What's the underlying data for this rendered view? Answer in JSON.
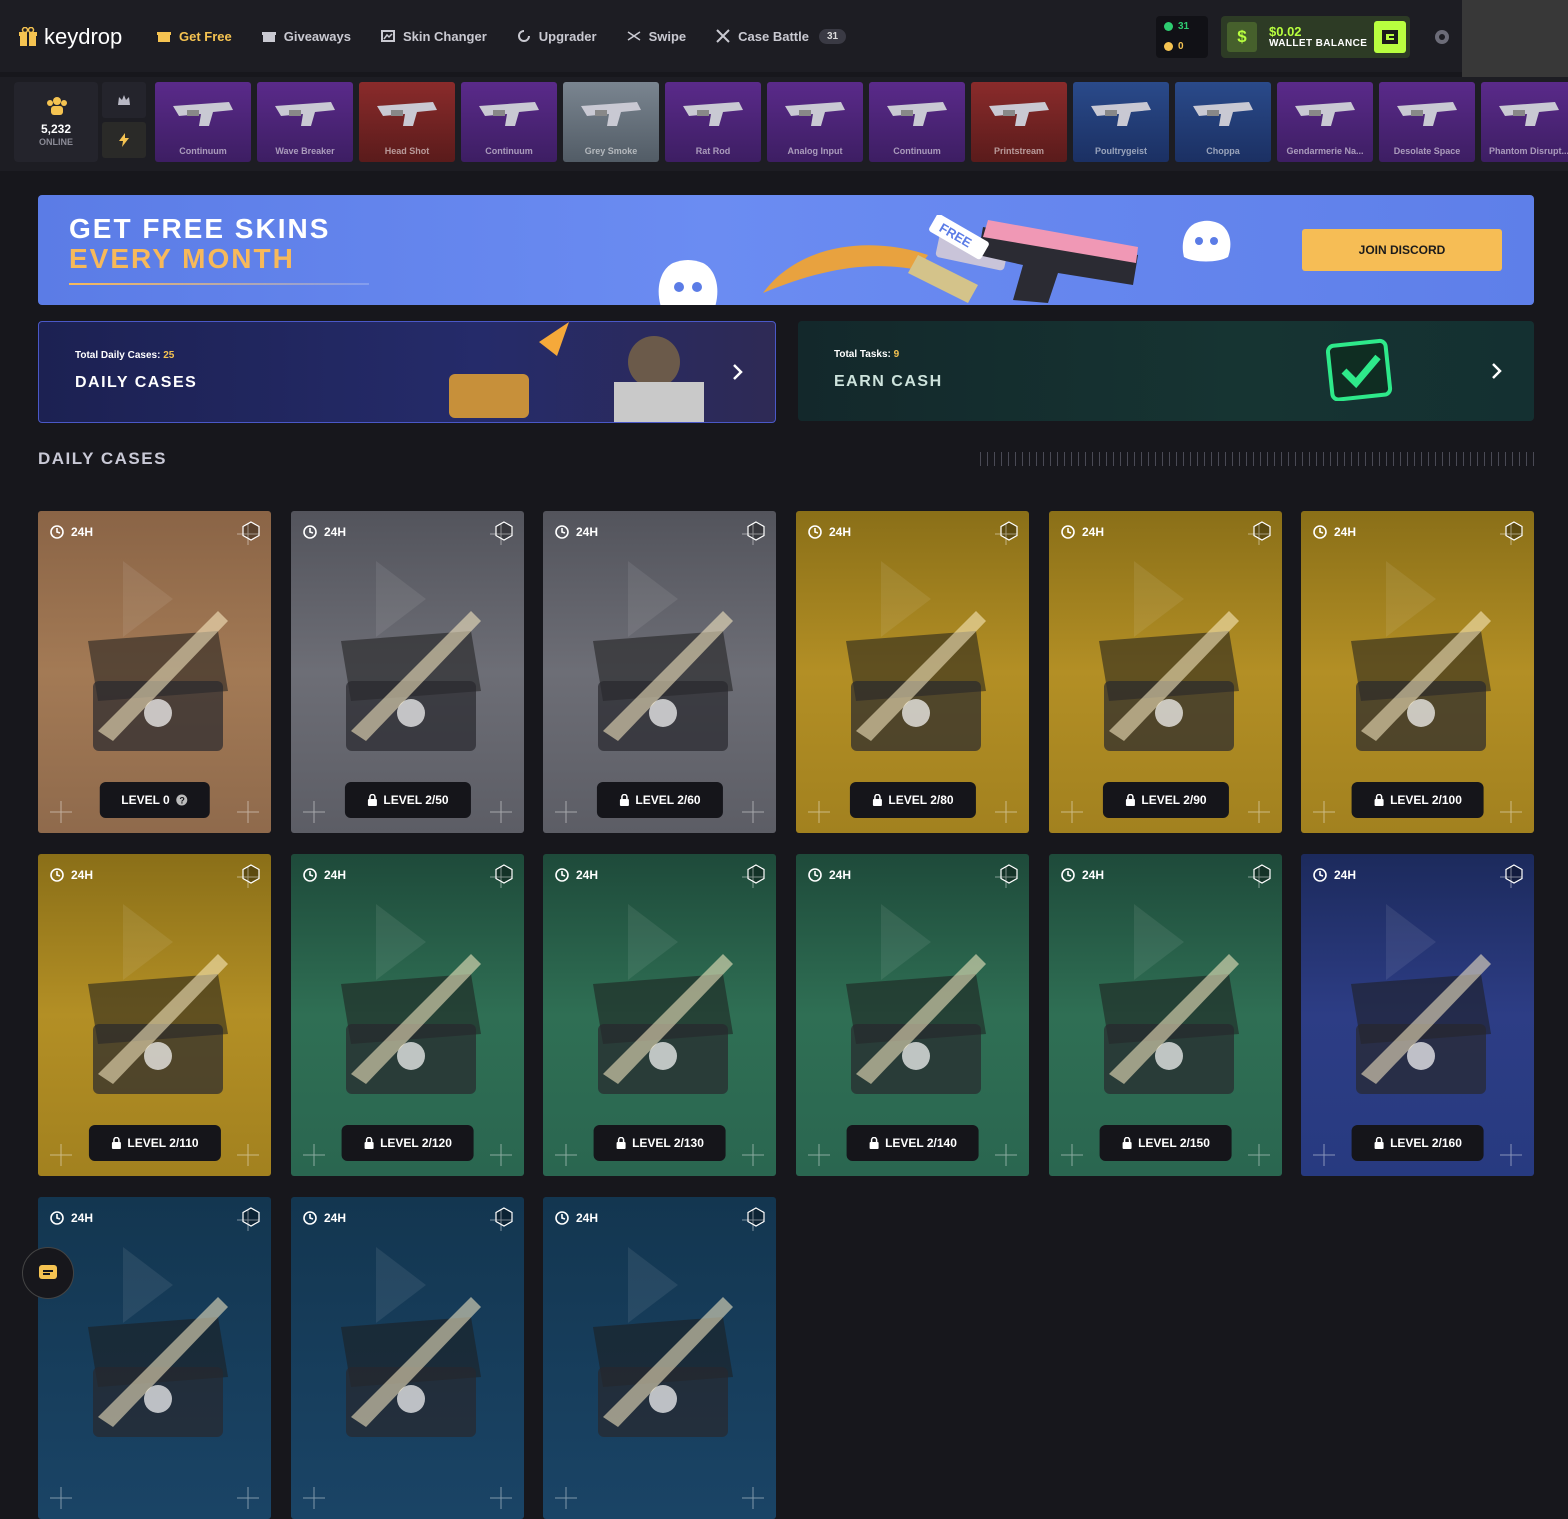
{
  "brand": {
    "name": "keydrop"
  },
  "nav": [
    {
      "label": "Get Free",
      "icon": "gift-icon",
      "active": true
    },
    {
      "label": "Giveaways",
      "icon": "gift-box-icon"
    },
    {
      "label": "Skin Changer",
      "icon": "image-icon"
    },
    {
      "label": "Upgrader",
      "icon": "refresh-icon"
    },
    {
      "label": "Swipe",
      "icon": "shuffle-icon"
    },
    {
      "label": "Case Battle",
      "icon": "crossed-swords-icon",
      "badge": "31"
    }
  ],
  "points": {
    "gold": "31",
    "coins": "0"
  },
  "wallet": {
    "amount": "$0.02",
    "label": "WALLET BALANCE",
    "symbol": "$"
  },
  "online": {
    "count": "5,232",
    "label": "ONLINE"
  },
  "drops": [
    {
      "name": "Continuum",
      "color": "purple"
    },
    {
      "name": "Wave Breaker",
      "color": "purple"
    },
    {
      "name": "Head Shot",
      "color": "red"
    },
    {
      "name": "Continuum",
      "color": "purple"
    },
    {
      "name": "Grey Smoke",
      "color": "grey"
    },
    {
      "name": "Rat Rod",
      "color": "purple"
    },
    {
      "name": "Analog Input",
      "color": "purple"
    },
    {
      "name": "Continuum",
      "color": "purple"
    },
    {
      "name": "Printstream",
      "color": "red"
    },
    {
      "name": "Poultrygeist",
      "color": "blue"
    },
    {
      "name": "Choppa",
      "color": "blue"
    },
    {
      "name": "Gendarmerie Na...",
      "color": "purple"
    },
    {
      "name": "Desolate Space",
      "color": "purple"
    },
    {
      "name": "Phantom Disrupt...",
      "color": "purple"
    }
  ],
  "banner": {
    "line1": "GET FREE SKINS",
    "line2": "EVERY MONTH",
    "free_tag": "FREE",
    "button": "JOIN DISCORD"
  },
  "promo": {
    "daily": {
      "small_label": "Total Daily Cases:",
      "small_value": "25",
      "title": "DAILY CASES"
    },
    "earn": {
      "small_label": "Total Tasks:",
      "small_value": "9",
      "title": "EARN CASH"
    }
  },
  "section_title": "DAILY CASES",
  "cases": [
    {
      "timer": "24H",
      "level": "LEVEL 0",
      "locked": false,
      "theme": "bronze"
    },
    {
      "timer": "24H",
      "level": "LEVEL 2/50",
      "locked": true,
      "theme": "silver"
    },
    {
      "timer": "24H",
      "level": "LEVEL 2/60",
      "locked": true,
      "theme": "silver"
    },
    {
      "timer": "24H",
      "level": "LEVEL 2/80",
      "locked": true,
      "theme": "gold"
    },
    {
      "timer": "24H",
      "level": "LEVEL 2/90",
      "locked": true,
      "theme": "gold"
    },
    {
      "timer": "24H",
      "level": "LEVEL 2/100",
      "locked": true,
      "theme": "gold"
    },
    {
      "timer": "24H",
      "level": "LEVEL 2/110",
      "locked": true,
      "theme": "gold"
    },
    {
      "timer": "24H",
      "level": "LEVEL 2/120",
      "locked": true,
      "theme": "green"
    },
    {
      "timer": "24H",
      "level": "LEVEL 2/130",
      "locked": true,
      "theme": "green"
    },
    {
      "timer": "24H",
      "level": "LEVEL 2/140",
      "locked": true,
      "theme": "green"
    },
    {
      "timer": "24H",
      "level": "LEVEL 2/150",
      "locked": true,
      "theme": "green"
    },
    {
      "timer": "24H",
      "level": "LEVEL 2/160",
      "locked": true,
      "theme": "blue"
    },
    {
      "timer": "24H",
      "level": "",
      "locked": true,
      "theme": "navy"
    },
    {
      "timer": "24H",
      "level": "",
      "locked": true,
      "theme": "navy"
    },
    {
      "timer": "24H",
      "level": "",
      "locked": true,
      "theme": "navy"
    }
  ]
}
